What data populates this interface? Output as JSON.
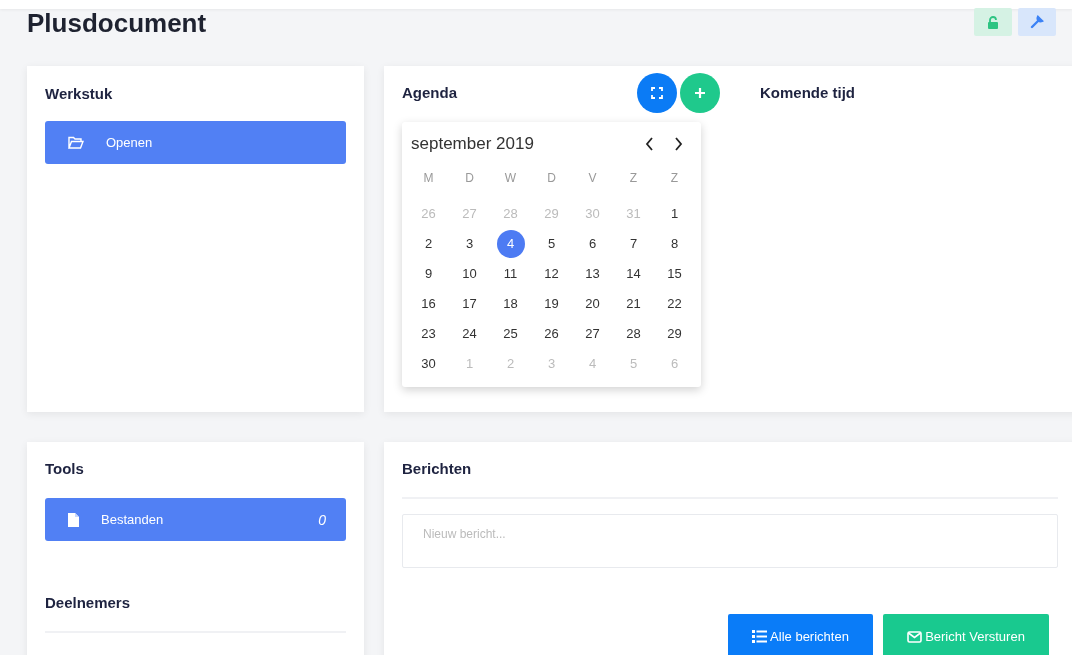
{
  "page": {
    "title": "Plusdocument"
  },
  "werkstuk": {
    "title": "Werkstuk",
    "button": "Openen"
  },
  "agenda": {
    "title": "Agenda",
    "calendar": {
      "month": "september 2019",
      "weekdays": [
        "M",
        "D",
        "W",
        "D",
        "V",
        "Z",
        "Z"
      ],
      "weeks": [
        [
          {
            "day": "26",
            "outside": true,
            "selected": false
          },
          {
            "day": "27",
            "outside": true,
            "selected": false
          },
          {
            "day": "28",
            "outside": true,
            "selected": false
          },
          {
            "day": "29",
            "outside": true,
            "selected": false
          },
          {
            "day": "30",
            "outside": true,
            "selected": false
          },
          {
            "day": "31",
            "outside": true,
            "selected": false
          },
          {
            "day": "1",
            "outside": false,
            "selected": false
          }
        ],
        [
          {
            "day": "2",
            "outside": false,
            "selected": false
          },
          {
            "day": "3",
            "outside": false,
            "selected": false
          },
          {
            "day": "4",
            "outside": false,
            "selected": true
          },
          {
            "day": "5",
            "outside": false,
            "selected": false
          },
          {
            "day": "6",
            "outside": false,
            "selected": false
          },
          {
            "day": "7",
            "outside": false,
            "selected": false
          },
          {
            "day": "8",
            "outside": false,
            "selected": false
          }
        ],
        [
          {
            "day": "9",
            "outside": false,
            "selected": false
          },
          {
            "day": "10",
            "outside": false,
            "selected": false
          },
          {
            "day": "11",
            "outside": false,
            "selected": false
          },
          {
            "day": "12",
            "outside": false,
            "selected": false
          },
          {
            "day": "13",
            "outside": false,
            "selected": false
          },
          {
            "day": "14",
            "outside": false,
            "selected": false
          },
          {
            "day": "15",
            "outside": false,
            "selected": false
          }
        ],
        [
          {
            "day": "16",
            "outside": false,
            "selected": false
          },
          {
            "day": "17",
            "outside": false,
            "selected": false
          },
          {
            "day": "18",
            "outside": false,
            "selected": false
          },
          {
            "day": "19",
            "outside": false,
            "selected": false
          },
          {
            "day": "20",
            "outside": false,
            "selected": false
          },
          {
            "day": "21",
            "outside": false,
            "selected": false
          },
          {
            "day": "22",
            "outside": false,
            "selected": false
          }
        ],
        [
          {
            "day": "23",
            "outside": false,
            "selected": false
          },
          {
            "day": "24",
            "outside": false,
            "selected": false
          },
          {
            "day": "25",
            "outside": false,
            "selected": false
          },
          {
            "day": "26",
            "outside": false,
            "selected": false
          },
          {
            "day": "27",
            "outside": false,
            "selected": false
          },
          {
            "day": "28",
            "outside": false,
            "selected": false
          },
          {
            "day": "29",
            "outside": false,
            "selected": false
          }
        ],
        [
          {
            "day": "30",
            "outside": false,
            "selected": false
          },
          {
            "day": "1",
            "outside": true,
            "selected": false
          },
          {
            "day": "2",
            "outside": true,
            "selected": false
          },
          {
            "day": "3",
            "outside": true,
            "selected": false
          },
          {
            "day": "4",
            "outside": true,
            "selected": false
          },
          {
            "day": "5",
            "outside": true,
            "selected": false
          },
          {
            "day": "6",
            "outside": true,
            "selected": false
          }
        ]
      ]
    }
  },
  "komende_tijd": {
    "title": "Komende tijd"
  },
  "tools": {
    "title": "Tools",
    "items": [
      {
        "label": "Bestanden",
        "count": "0"
      }
    ]
  },
  "deelnemers": {
    "title": "Deelnemers"
  },
  "berichten": {
    "title": "Berichten",
    "message_field": {
      "placeholder": "Nieuw bericht..."
    },
    "buttons": [
      {
        "label": "Alle berichten",
        "kind": "list"
      },
      {
        "label": "Bericht Versturen",
        "kind": "send"
      }
    ]
  }
}
